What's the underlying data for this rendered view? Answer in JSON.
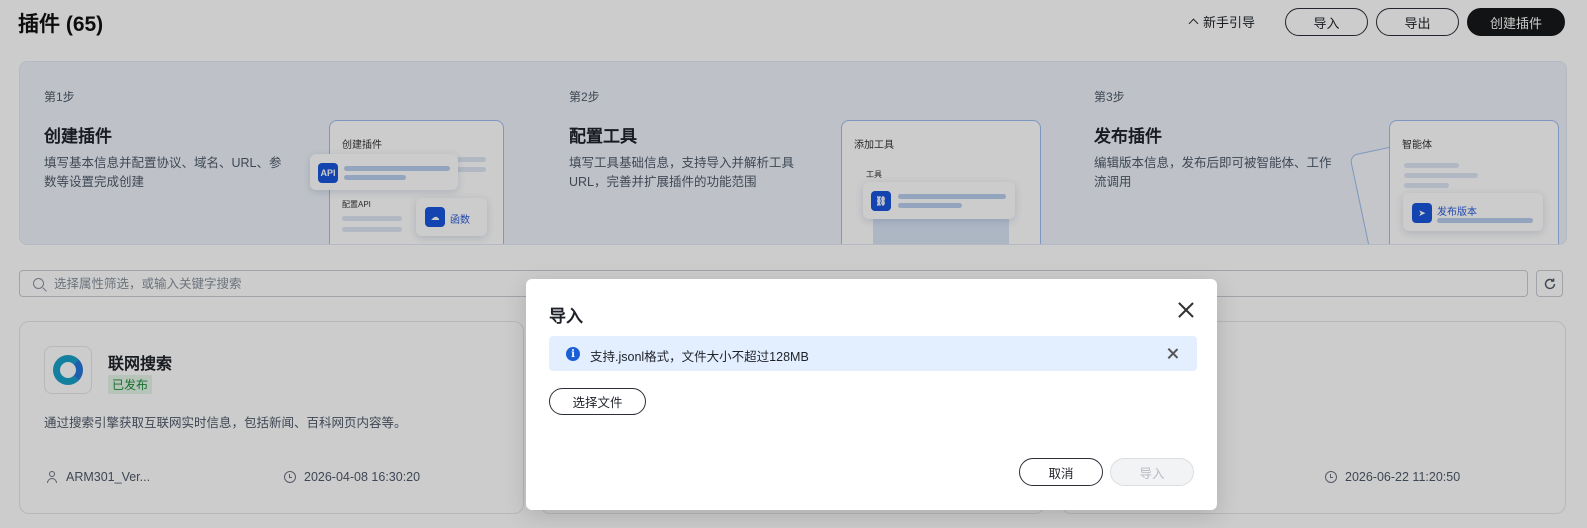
{
  "header": {
    "title": "插件 (65)",
    "guide_label": "新手引导",
    "import_label": "导入",
    "export_label": "导出",
    "create_label": "创建插件"
  },
  "steps": [
    {
      "step": "第1步",
      "title": "创建插件",
      "desc": "填写基本信息并配置协议、域名、URL、参数等设置完成创建",
      "illus_title": "创建插件",
      "illus_sub": "配置API",
      "float_a": "API",
      "float_b": "函数"
    },
    {
      "step": "第2步",
      "title": "配置工具",
      "desc": "填写工具基础信息，支持导入并解析工具URL，完善并扩展插件的功能范围",
      "illus_title": "添加工具",
      "illus_sub": "工具"
    },
    {
      "step": "第3步",
      "title": "发布插件",
      "desc": "编辑版本信息，发布后即可被智能体、工作流调用",
      "illus_title": "智能体",
      "float_b": "发布版本"
    }
  ],
  "search": {
    "placeholder": "选择属性筛选，或输入关键字搜索"
  },
  "card": {
    "name": "联网搜索",
    "status": "已发布",
    "desc": "通过搜索引擎获取互联网实时信息，包括新闻、百科网页内容等。",
    "owner": "ARM301_Ver...",
    "time": "2026-04-08 16:30:20"
  },
  "card3": {
    "time": "2026-06-22 11:20:50"
  },
  "modal": {
    "title": "导入",
    "info": "支持.jsonl格式，文件大小不超过128MB",
    "choose_file": "选择文件",
    "cancel": "取消",
    "import": "导入"
  },
  "colors": {
    "primary_button": "#17181a",
    "info_banner": "#e3eefe",
    "published_badge": "#1e8c3c"
  }
}
